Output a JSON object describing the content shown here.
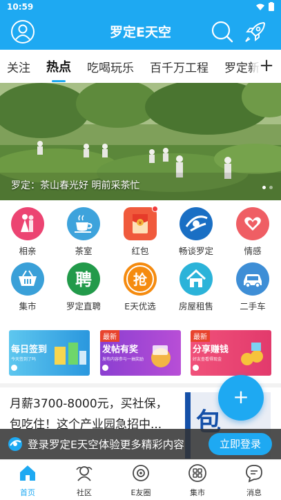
{
  "status": {
    "time": "10:59"
  },
  "header": {
    "title": "罗定E天空",
    "profile_icon": "user-icon",
    "search_icon": "search-icon",
    "rocket_icon": "rocket-icon"
  },
  "tabs": [
    {
      "label": "关注",
      "active": false
    },
    {
      "label": "热点",
      "active": true
    },
    {
      "label": "吃喝玩乐",
      "active": false
    },
    {
      "label": "百千万工程",
      "active": false
    },
    {
      "label": "罗定新",
      "active": false
    }
  ],
  "banner": {
    "caption": "罗定：茶山春光好 明前采茶忙"
  },
  "grid": [
    {
      "label": "相亲",
      "icon": "couple-icon",
      "color": "#ec4472"
    },
    {
      "label": "茶室",
      "icon": "tea-cup-icon",
      "color": "#3ea3dc"
    },
    {
      "label": "红包",
      "icon": "red-envelope-icon",
      "color": "#f05a3c"
    },
    {
      "label": "畅谈罗定",
      "icon": "chat-logo-icon",
      "color": "#1a6fc4"
    },
    {
      "label": "情感",
      "icon": "hearts-icon",
      "color": "#ef5e64"
    },
    {
      "label": "集市",
      "icon": "basket-icon",
      "color": "#3aa0d8"
    },
    {
      "label": "罗定直聘",
      "icon": "recruit-icon",
      "color": "#229a4a"
    },
    {
      "label": "E天优选",
      "icon": "select-icon",
      "color": "#f58b0f"
    },
    {
      "label": "房屋租售",
      "icon": "house-icon",
      "color": "#2bb3d9"
    },
    {
      "label": "二手车",
      "icon": "car-icon",
      "color": "#3e8ed6"
    }
  ],
  "promos": [
    {
      "title": "每日签到",
      "sub": "今天签到了吗",
      "new": ""
    },
    {
      "title": "发帖有奖",
      "sub": "发布内容参与一抽奖励",
      "new": "最新"
    },
    {
      "title": "分享赚钱",
      "sub": "好友查看得现金",
      "new": "最新"
    }
  ],
  "article": {
    "text": "月薪3700-8000元，买社保，包吃住！这个产业园急招中...",
    "thumb_text": "包"
  },
  "fab": {
    "label": "+"
  },
  "login": {
    "text": "登录罗定E天空体验更多精彩内容",
    "button": "立即登录"
  },
  "nav": [
    {
      "label": "首页",
      "icon": "home-icon",
      "active": true
    },
    {
      "label": "社区",
      "icon": "community-icon",
      "active": false
    },
    {
      "label": "E友圈",
      "icon": "circle-icon",
      "active": false
    },
    {
      "label": "集市",
      "icon": "market-icon",
      "active": false
    },
    {
      "label": "消息",
      "icon": "message-icon",
      "active": false
    }
  ]
}
